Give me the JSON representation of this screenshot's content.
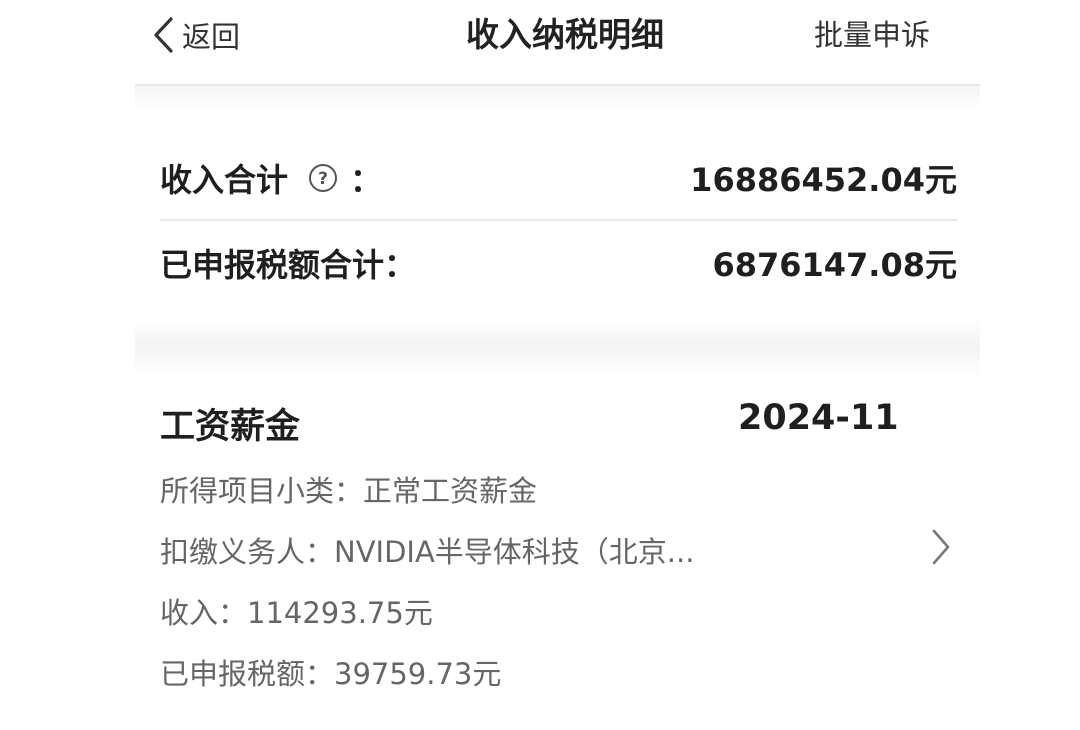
{
  "header": {
    "back_label": "返回",
    "title": "收入纳税明细",
    "batch_label": "批量申诉"
  },
  "summary": {
    "income_label": "收入合计",
    "income_colon": "：",
    "income_value": "16886452.04元",
    "tax_label": "已申报税额合计：",
    "tax_value": "6876147.08元"
  },
  "record": {
    "title": "工资薪金",
    "date": "2024-11",
    "subcategory": "所得项目小类：正常工资薪金",
    "withholder": "扣缴义务人：NVIDIA半导体科技（北京...",
    "income": "收入：114293.75元",
    "tax": "已申报税额：39759.73元"
  },
  "icons": {
    "back": "chevron-left-icon",
    "help": "question-circle-icon",
    "detail": "chevron-right-icon"
  },
  "colors": {
    "text_primary": "#1f1f1f",
    "text_secondary": "#666666",
    "divider": "#e8e8e8"
  }
}
